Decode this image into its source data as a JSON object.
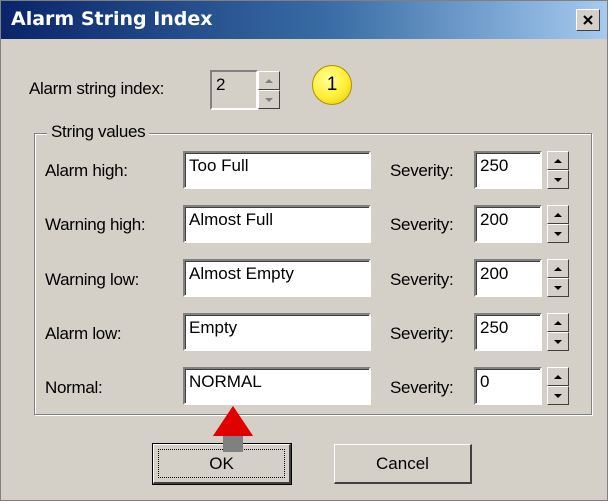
{
  "window": {
    "title": "Alarm String Index"
  },
  "index": {
    "label": "Alarm string index:",
    "value": "2",
    "badge": "1"
  },
  "group": {
    "label": "String values"
  },
  "rows": [
    {
      "label": "Alarm high:",
      "value": "Too Full",
      "severity_label": "Severity:",
      "severity": "250"
    },
    {
      "label": "Warning high:",
      "value": "Almost Full",
      "severity_label": "Severity:",
      "severity": "200"
    },
    {
      "label": "Warning low:",
      "value": "Almost Empty",
      "severity_label": "Severity:",
      "severity": "200"
    },
    {
      "label": "Alarm low:",
      "value": "Empty",
      "severity_label": "Severity:",
      "severity": "250"
    },
    {
      "label": "Normal:",
      "value": "NORMAL",
      "severity_label": "Severity:",
      "severity": "0"
    }
  ],
  "buttons": {
    "ok": "OK",
    "cancel": "Cancel"
  },
  "colors": {
    "titlebar_start": "#0a246a",
    "titlebar_end": "#a6caf0",
    "pointer": "#e00000",
    "badge": "#ffee33"
  }
}
